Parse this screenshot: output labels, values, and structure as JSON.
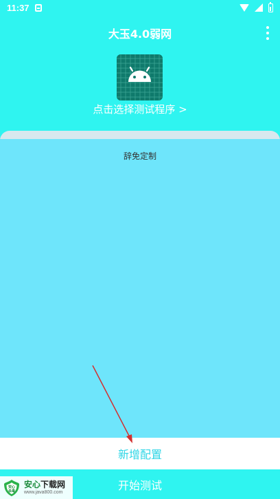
{
  "status_bar": {
    "time": "11:37",
    "icons": [
      "notification-icon",
      "wifi-icon",
      "signal-icon",
      "battery-icon"
    ]
  },
  "app_bar": {
    "title": "大玉4.0弱网",
    "menu_icon": "more-vert-icon"
  },
  "header": {
    "app_icon": "android-icon",
    "select_program_label": "点击选择测试程序 >"
  },
  "config_list": {
    "items": [
      "辞免定制"
    ]
  },
  "buttons": {
    "add_config_label": "新增配置",
    "start_test_label": "开始测试"
  },
  "watermark": {
    "logo_text": "安心\n杀毒",
    "name_colored": "安心",
    "name_rest": "下载网",
    "url": "www.java800.com"
  },
  "colors": {
    "background": "#2FF4F0",
    "panel": "#6EE5FB",
    "panel_header": "#D8E8EE",
    "add_config_text": "#2ED6E6",
    "icon_bg": "#0F7A6C",
    "arrow": "#D32F2F"
  }
}
